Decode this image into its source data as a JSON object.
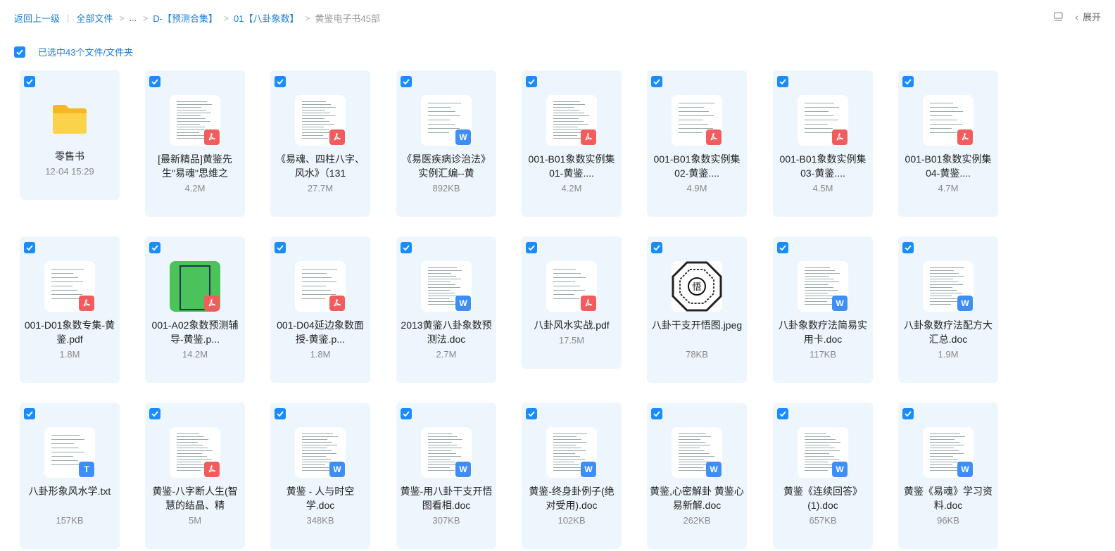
{
  "breadcrumb": {
    "back": "返回上一级",
    "all_files": "全部文件",
    "ellipsis": "...",
    "level1": "D-【预测合集】",
    "level2": "01【八卦象数】",
    "current": "黄鉴电子书45部"
  },
  "toolbar": {
    "expand_label": "展开"
  },
  "selection": {
    "label": "已选中43个文件/文件夹"
  },
  "files": [
    {
      "name": "零售书",
      "meta": "12-04 15:29",
      "type": "folder"
    },
    {
      "name": "[最新精品]黄鉴先生\"易魂\"思维之",
      "meta": "4.2M",
      "type": "pdf"
    },
    {
      "name": "《易魂、四柱八字、风水》（131",
      "meta": "27.7M",
      "type": "pdf"
    },
    {
      "name": "《易医疾病诊治法》实例汇编--黄",
      "meta": "892KB",
      "type": "doc"
    },
    {
      "name": "001-B01象数实例集01-黄鉴....",
      "meta": "4.2M",
      "type": "pdf"
    },
    {
      "name": "001-B01象数实例集02-黄鉴....",
      "meta": "4.9M",
      "type": "pdf"
    },
    {
      "name": "001-B01象数实例集03-黄鉴....",
      "meta": "4.5M",
      "type": "pdf"
    },
    {
      "name": "001-B01象数实例集04-黄鉴....",
      "meta": "4.7M",
      "type": "pdf"
    },
    {
      "name": "001-D01象数专集-黄鉴.pdf",
      "meta": "1.8M",
      "type": "pdf"
    },
    {
      "name": "001-A02象数预测辅导-黄鉴.p...",
      "meta": "14.2M",
      "type": "pdf"
    },
    {
      "name": "001-D04延边象数面授-黄鉴.p...",
      "meta": "1.8M",
      "type": "pdf"
    },
    {
      "name": "2013黄鉴八卦象数预测法.doc",
      "meta": "2.7M",
      "type": "doc"
    },
    {
      "name": "八卦风水实战.pdf",
      "meta": "17.5M",
      "type": "pdf"
    },
    {
      "name": "八卦干支开悟图.jpeg",
      "meta": "78KB",
      "type": "image"
    },
    {
      "name": "八卦象数疗法简易实用卡.doc",
      "meta": "117KB",
      "type": "doc"
    },
    {
      "name": "八卦象数疗法配方大汇总.doc",
      "meta": "1.9M",
      "type": "doc"
    },
    {
      "name": "八卦形象风水学.txt",
      "meta": "157KB",
      "type": "txt"
    },
    {
      "name": "黄鉴-八字断人生(智慧的结晶、精",
      "meta": "5M",
      "type": "pdf"
    },
    {
      "name": "黄鉴 - 人与时空学.doc",
      "meta": "348KB",
      "type": "doc"
    },
    {
      "name": "黄鉴-用八卦干支开悟图看相.doc",
      "meta": "307KB",
      "type": "doc"
    },
    {
      "name": "黄鉴-终身卦例子(绝对受用).doc",
      "meta": "102KB",
      "type": "doc"
    },
    {
      "name": "黄鉴,心密解卦 黄鉴心易新解.doc",
      "meta": "262KB",
      "type": "doc"
    },
    {
      "name": "黄鉴《连续回答》(1).doc",
      "meta": "657KB",
      "type": "doc"
    },
    {
      "name": "黄鉴《易魂》学习资料.doc",
      "meta": "96KB",
      "type": "doc"
    }
  ],
  "colors": {
    "accent": "#1a8cff",
    "link": "#1a7ed9",
    "card_bg": "#eef6fd",
    "pdf": "#f25c5c",
    "doc": "#3e8ef7"
  }
}
